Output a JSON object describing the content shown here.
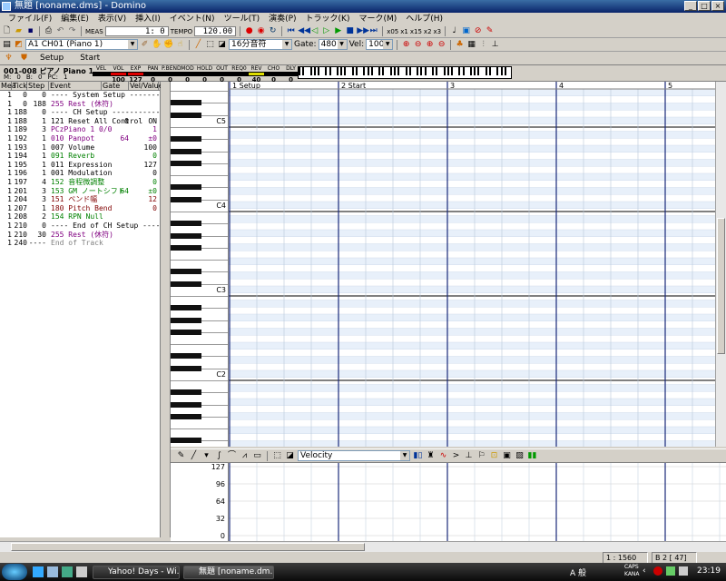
{
  "window": {
    "title": "無題 [noname.dms] - Domino"
  },
  "menu": [
    "ファイル(F)",
    "編集(E)",
    "表示(V)",
    "挿入(I)",
    "イベント(N)",
    "ツール(T)",
    "演奏(P)",
    "トラック(K)",
    "マーク(M)",
    "ヘルプ(H)"
  ],
  "transport": {
    "meas_label": "MEAS",
    "position": "1:    0",
    "tempo_label": "TEMPO",
    "tempo": "120.00",
    "speeds": [
      "x05",
      "x1",
      "x15",
      "x2",
      "x3"
    ]
  },
  "toolbar2": {
    "track_select": "A1 CH01 (Piano 1)",
    "quantize": "16分音符",
    "gate_label": "Gate:",
    "gate": "480",
    "vel_label": "Vel:",
    "vel": "100"
  },
  "tabs": {
    "setup": "Setup",
    "start": "Start"
  },
  "trackinfo": {
    "name": "001-008 ピアノ Piano 1",
    "m_label": "M:",
    "m": "0",
    "b_label": "B:",
    "b": "0",
    "pc_label": "PC:",
    "pc": "1",
    "params": [
      {
        "label": "VEL",
        "value": "",
        "color": "#000000"
      },
      {
        "label": "VOL",
        "value": "100",
        "color": "#e00000"
      },
      {
        "label": "EXP",
        "value": "127",
        "color": "#e00000"
      },
      {
        "label": "PAN",
        "value": "0",
        "color": "#000000"
      },
      {
        "label": "P.BEND",
        "value": "0",
        "color": "#000000"
      },
      {
        "label": "MOD",
        "value": "0",
        "color": "#000000"
      },
      {
        "label": "HOLD",
        "value": "0",
        "color": "#000000"
      },
      {
        "label": "OUT",
        "value": "0",
        "color": "#000000"
      },
      {
        "label": "REQ0",
        "value": "0",
        "color": "#000000"
      },
      {
        "label": "REV",
        "value": "40",
        "color": "#e0e000"
      },
      {
        "label": "CHO",
        "value": "0",
        "color": "#000000"
      },
      {
        "label": "DLY",
        "value": "0",
        "color": "#000000"
      }
    ]
  },
  "eventlist": {
    "headers": [
      "Mea",
      "Tick",
      "Step",
      "Event",
      "Gate",
      "Vel/Value"
    ],
    "rows": [
      {
        "mea": "1",
        "tick": "0",
        "step": "0",
        "event": "---- System Setup ------------",
        "gate": "",
        "value": "",
        "color": "#000000"
      },
      {
        "mea": "1",
        "tick": "0",
        "step": "188",
        "event": "255 Rest (休符)",
        "gate": "",
        "value": "",
        "color": "#800080"
      },
      {
        "mea": "1",
        "tick": "188",
        "step": "0",
        "event": "---- CH Setup ----------------",
        "gate": "",
        "value": "",
        "color": "#000000"
      },
      {
        "mea": "1",
        "tick": "188",
        "step": "1",
        "event": "121 Reset All Control",
        "gate": "0",
        "value": "ON",
        "color": "#000000"
      },
      {
        "mea": "1",
        "tick": "189",
        "step": "3",
        "event": "PCzPiano 1       0/0",
        "gate": "",
        "value": "1",
        "color": "#800080"
      },
      {
        "mea": "1",
        "tick": "192",
        "step": "1",
        "event": "010 Panpot",
        "gate": "64",
        "value": "±0",
        "color": "#800080"
      },
      {
        "mea": "1",
        "tick": "193",
        "step": "1",
        "event": "007 Volume",
        "gate": "",
        "value": "100",
        "color": "#000000"
      },
      {
        "mea": "1",
        "tick": "194",
        "step": "1",
        "event": "091 Reverb",
        "gate": "",
        "value": "0",
        "color": "#008000"
      },
      {
        "mea": "1",
        "tick": "195",
        "step": "1",
        "event": "011 Expression",
        "gate": "",
        "value": "127",
        "color": "#000000"
      },
      {
        "mea": "1",
        "tick": "196",
        "step": "1",
        "event": "001 Modulation",
        "gate": "",
        "value": "0",
        "color": "#000000"
      },
      {
        "mea": "1",
        "tick": "197",
        "step": "4",
        "event": "152 音程微調整",
        "gate": "",
        "value": "0",
        "color": "#008000"
      },
      {
        "mea": "1",
        "tick": "201",
        "step": "3",
        "event": "153 GM ノートシフト",
        "gate": "64",
        "value": "±0",
        "color": "#008000"
      },
      {
        "mea": "1",
        "tick": "204",
        "step": "3",
        "event": "151 ベンド幅",
        "gate": "",
        "value": "12",
        "color": "#800000"
      },
      {
        "mea": "1",
        "tick": "207",
        "step": "1",
        "event": "180 Pitch Bend",
        "gate": "",
        "value": "0",
        "color": "#800000"
      },
      {
        "mea": "1",
        "tick": "208",
        "step": "2",
        "event": "154 RPN Null",
        "gate": "",
        "value": "",
        "color": "#008000"
      },
      {
        "mea": "1",
        "tick": "210",
        "step": "0",
        "event": "---- End of CH Setup --------",
        "gate": "",
        "value": "",
        "color": "#000000"
      },
      {
        "mea": "1",
        "tick": "210",
        "step": "30",
        "event": "255 Rest (休符)",
        "gate": "",
        "value": "",
        "color": "#800080"
      },
      {
        "mea": "1",
        "tick": "240",
        "step": "----",
        "event": "End of Track",
        "gate": "",
        "value": "",
        "color": "#808080"
      }
    ]
  },
  "pianoroll": {
    "measures": [
      "1 Setup",
      "2 Start",
      "3",
      "4",
      "5"
    ],
    "octaves": [
      "C5",
      "C4",
      "C3",
      "C2"
    ]
  },
  "controller": {
    "select": "Velocity",
    "ticks": [
      "127",
      "96",
      "64",
      "32",
      "0"
    ]
  },
  "status": {
    "position": "1 : 1560",
    "beat": "B  2 [ 47]"
  },
  "taskbar": {
    "tasks": [
      "Yahoo! Days - Wi...",
      "無題 [noname.dm..."
    ],
    "ime": "A 般",
    "caps": "CAPS",
    "kana": "KANA",
    "clock": "23:19"
  }
}
